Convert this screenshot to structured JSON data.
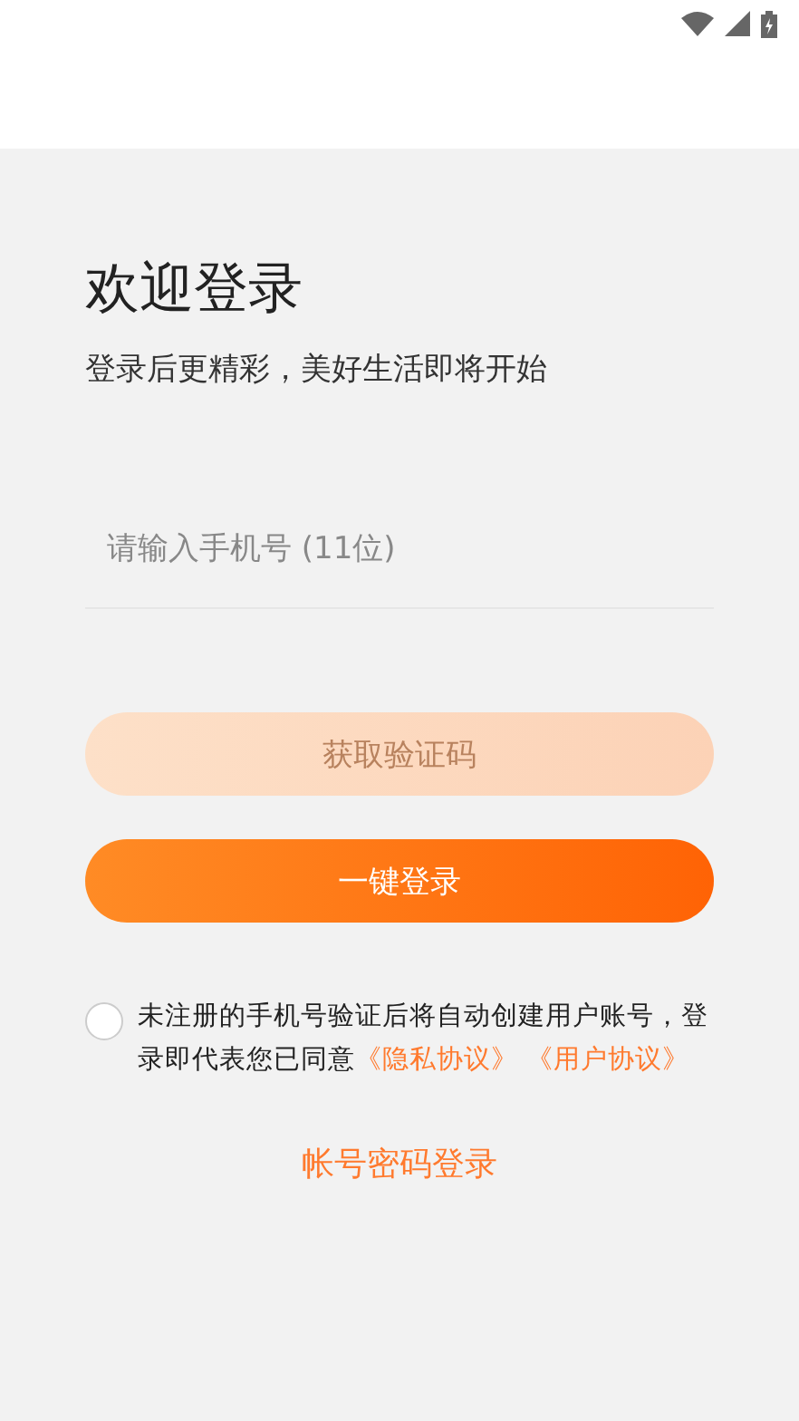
{
  "title": "欢迎登录",
  "subtitle": "登录后更精彩，美好生活即将开始",
  "phone_field": {
    "placeholder": "请输入手机号 (11位)"
  },
  "buttons": [
    {
      "label": "获取验证码",
      "disabled": true
    },
    {
      "label": "一键登录",
      "disabled": false
    }
  ],
  "agreement": {
    "checked": false,
    "text": "未注册的手机号验证后将自动创建用户账号，登录即代表您已同意",
    "links": [
      "《隐私协议》",
      "《用户协议》"
    ]
  },
  "password_login": "帐号密码登录"
}
